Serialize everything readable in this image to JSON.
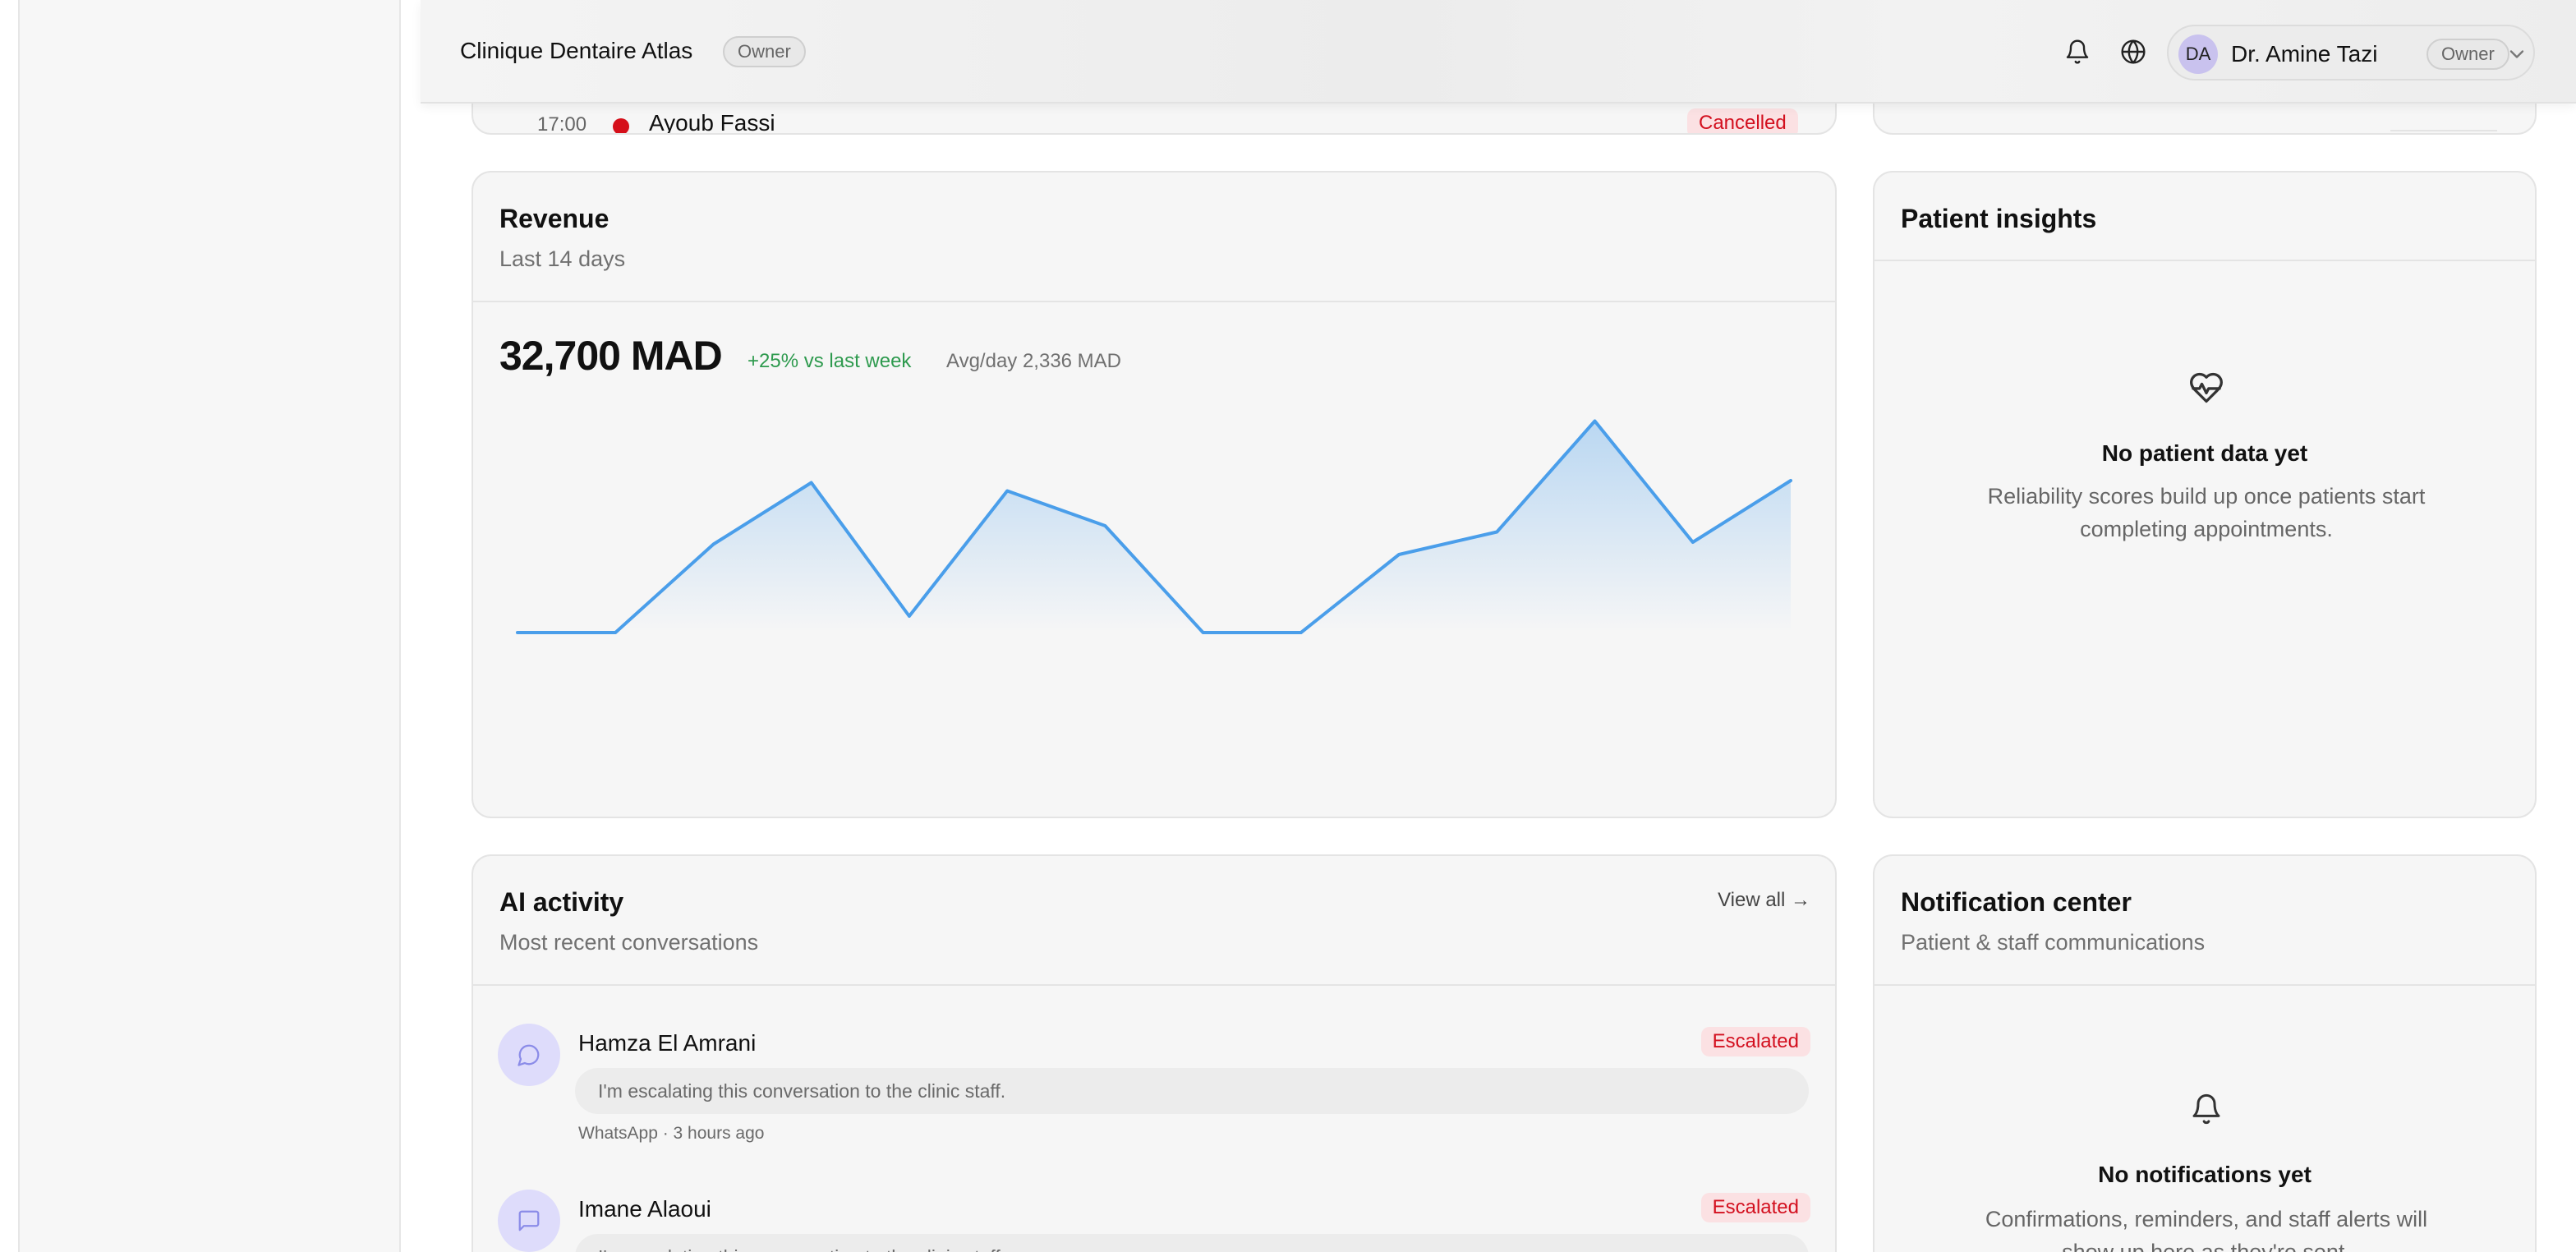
{
  "header": {
    "clinic_name": "Clinique Dentaire Atlas",
    "clinic_role": "Owner",
    "user": {
      "initials": "DA",
      "name": "Dr. Amine Tazi",
      "role": "Owner"
    },
    "icons": [
      "bell-icon",
      "globe-icon",
      "chevron-down-icon"
    ]
  },
  "appointment": {
    "time": "17:00",
    "patient": "Ayoub Fassi",
    "status": "Cancelled",
    "status_color": "#d3101f"
  },
  "revenue": {
    "title": "Revenue",
    "subtitle": "Last 14 days",
    "total": "32,700 MAD",
    "change": "+25% vs last week",
    "average": "Avg/day 2,336 MAD",
    "line_color": "#4a9eea",
    "change_color": "#2e9a4e"
  },
  "chart_data": {
    "type": "area",
    "title": "",
    "xlabel": "",
    "ylabel": "",
    "x": [
      1,
      2,
      3,
      4,
      5,
      6,
      7,
      8,
      9,
      10,
      11,
      12,
      13,
      14
    ],
    "values": [
      0,
      0,
      2150,
      3650,
      400,
      3450,
      2600,
      0,
      0,
      1900,
      2450,
      5150,
      2200,
      3700
    ],
    "ylim": [
      0,
      6000
    ],
    "grid": false,
    "legend": "none"
  },
  "patient_insights": {
    "title": "Patient insights",
    "empty_title": "No patient data yet",
    "empty_text": "Reliability scores build up once patients start completing appointments.",
    "icon": "heart-pulse-icon"
  },
  "ai_activity": {
    "title": "AI activity",
    "subtitle": "Most recent conversations",
    "view_all": "View all →",
    "conversations": [
      {
        "name": "Hamza El Amrani",
        "status": "Escalated",
        "message": "I'm escalating this conversation to the clinic staff.",
        "meta": "WhatsApp · 3 hours ago",
        "icon": "chat-bubble-icon"
      },
      {
        "name": "Imane Alaoui",
        "status": "Escalated",
        "message": "I'm escalating this conversation to the clinic staff.",
        "icon": "message-square-icon"
      }
    ]
  },
  "notification_center": {
    "title": "Notification center",
    "subtitle": "Patient & staff communications",
    "empty_title": "No notifications yet",
    "empty_text": "Confirmations, reminders, and staff alerts will show up here as they're sent.",
    "icon": "bell-icon"
  }
}
